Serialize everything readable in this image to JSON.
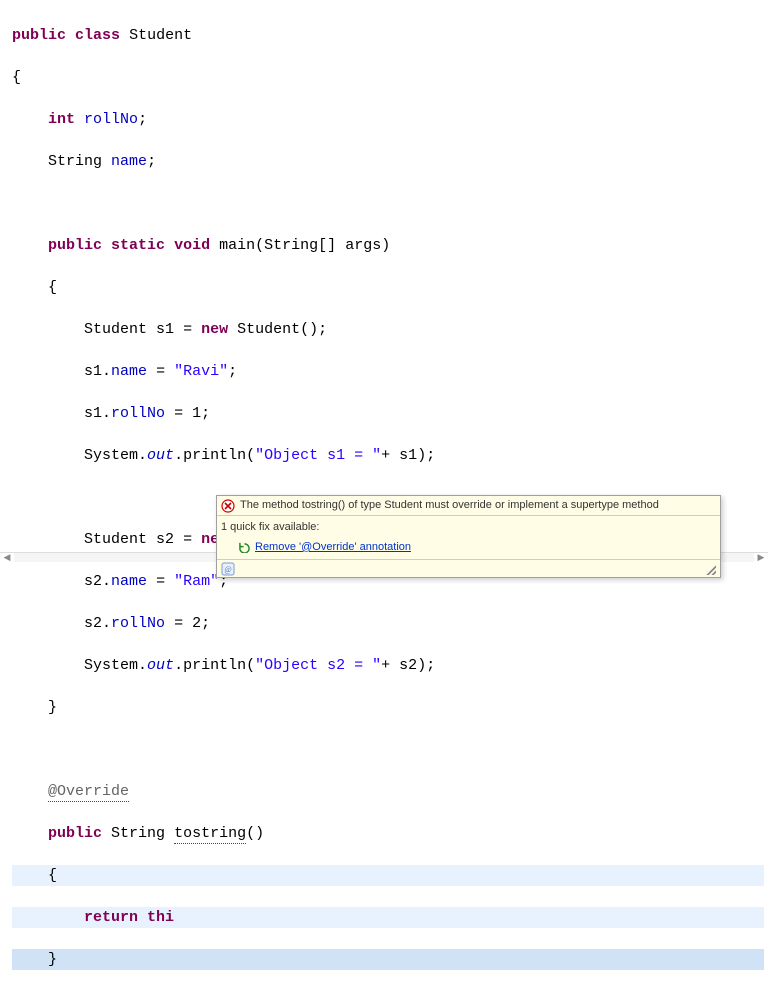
{
  "code": {
    "tokens": {
      "public": "public",
      "class": "class",
      "className": "Student",
      "int": "int",
      "rollNo": "rollNo",
      "String": "String",
      "name": "name",
      "static": "static",
      "void": "void",
      "main": "main",
      "args": "args",
      "s1": "s1",
      "s2": "s2",
      "new": "new",
      "StudentCtor": "Student()",
      "Ravi": "\"Ravi\"",
      "Ram": "\"Ram\"",
      "one": "1",
      "two": "2",
      "System": "System",
      "out": "out",
      "println": "println",
      "objS1": "\"Object s1 = \"",
      "objS2": "\"Object s2 = \"",
      "Override": "@Override",
      "tostring": "tostring",
      "return": "return",
      "thi": "thi",
      "lbrace": "{",
      "rbrace": "}",
      "lparen": "(",
      "rparen": ")",
      "lbracket": "[",
      "rbracket": "]",
      "semi": ";",
      "dot": ".",
      "eq": "=",
      "plus": "+"
    }
  },
  "tooltip": {
    "errorMessage": "The method tostring() of type Student must override or implement a supertype method",
    "quickFixHeader": "1 quick fix available:",
    "quickFixLink": "Remove '@Override' annotation"
  }
}
